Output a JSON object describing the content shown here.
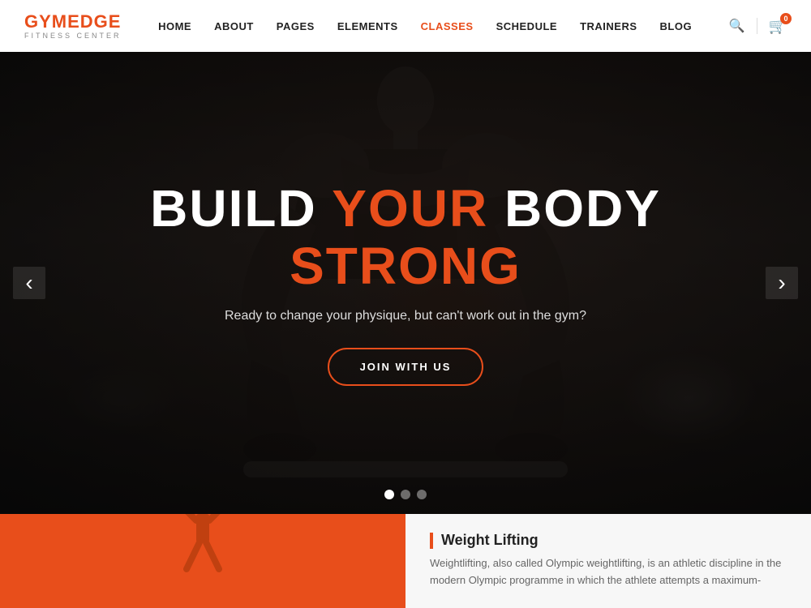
{
  "header": {
    "logo": {
      "brand": "GYM",
      "brand_accent": "EDGE",
      "subtitle": "FITNESS CENTER"
    },
    "nav": {
      "items": [
        {
          "label": "HOME",
          "id": "home",
          "active": false
        },
        {
          "label": "ABOUT",
          "id": "about",
          "active": false
        },
        {
          "label": "PAGES",
          "id": "pages",
          "active": false
        },
        {
          "label": "ELEMENTS",
          "id": "elements",
          "active": false
        },
        {
          "label": "CLASSES",
          "id": "classes",
          "active": true
        },
        {
          "label": "SCHEDULE",
          "id": "schedule",
          "active": false
        },
        {
          "label": "TRAINERS",
          "id": "trainers",
          "active": false
        },
        {
          "label": "BLOG",
          "id": "blog",
          "active": false
        }
      ]
    },
    "cart_badge": "0"
  },
  "hero": {
    "title_part1": "BUILD ",
    "title_part2": "YOUR",
    "title_part3": " BODY ",
    "title_part4": "STRONG",
    "subtitle": "Ready to change your physique, but can't work out in the gym?",
    "cta_label": "JOIN WITH US",
    "carousel_dots": [
      {
        "active": true
      },
      {
        "active": false
      },
      {
        "active": false
      }
    ]
  },
  "bottom": {
    "section_title": "Weight Lifting",
    "section_text": "Weightlifting, also called Olympic weightlifting, is an athletic discipline in the modern Olympic programme in which the athlete attempts a maximum-"
  },
  "colors": {
    "accent": "#e84e1b",
    "dark": "#1a1a1a",
    "white": "#ffffff",
    "light_bg": "#f7f7f7"
  }
}
